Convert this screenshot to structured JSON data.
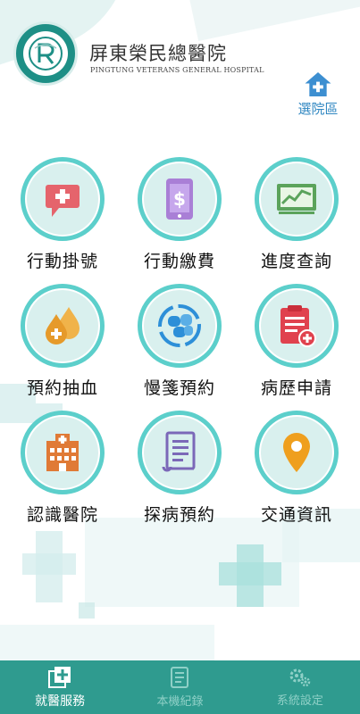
{
  "header": {
    "hospital_name": "屏東榮民總醫院",
    "hospital_name_en": "PINGTUNG VETERANS GENERAL HOSPITAL",
    "logo_icon": "hospital-logo",
    "branch_button": {
      "label": "選院區",
      "icon": "home-plus-icon"
    }
  },
  "menu": [
    {
      "label": "行動掛號",
      "icon": "chat-plus-icon",
      "color": "#e5646c"
    },
    {
      "label": "行動繳費",
      "icon": "phone-dollar-icon",
      "color": "#a97fd6"
    },
    {
      "label": "進度查詢",
      "icon": "chart-monitor-icon",
      "color": "#5ba35b"
    },
    {
      "label": "預約抽血",
      "icon": "blood-drop-icon",
      "color": "#e69a2a"
    },
    {
      "label": "慢箋預約",
      "icon": "pills-icon",
      "color": "#2d8fd8"
    },
    {
      "label": "病歷申請",
      "icon": "clipboard-plus-icon",
      "color": "#e0424e"
    },
    {
      "label": "認識醫院",
      "icon": "hospital-building-icon",
      "color": "#e07a36"
    },
    {
      "label": "探病預約",
      "icon": "document-icon",
      "color": "#7b68b8"
    },
    {
      "label": "交通資訊",
      "icon": "map-pin-icon",
      "color": "#ef9f1e"
    }
  ],
  "bottom_nav": [
    {
      "label": "就醫服務",
      "icon": "medical-service-icon",
      "active": true
    },
    {
      "label": "本機紀錄",
      "icon": "records-icon",
      "active": false
    },
    {
      "label": "系統設定",
      "icon": "gears-icon",
      "active": false
    }
  ],
  "colors": {
    "brand": "#2f9b8f",
    "ring": "#5ccfcb",
    "ring_fill": "#d9f0ee",
    "link": "#2e86c1"
  }
}
